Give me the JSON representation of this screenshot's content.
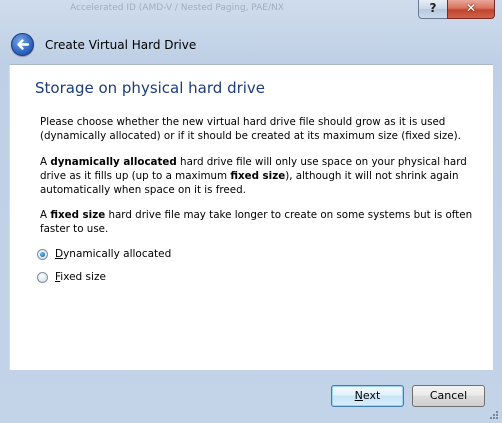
{
  "titlebar": {
    "faded_text": "Accelerated   ID (AMD-V / Nested Paging, PAE/NX",
    "help_glyph": "?",
    "close_glyph": "✕"
  },
  "header": {
    "title": "Create Virtual Hard Drive"
  },
  "page": {
    "title": "Storage on physical hard drive",
    "p1": "Please choose whether the new virtual hard drive file should grow as it is used (dynamically allocated) or if it should be created at its maximum size (fixed size).",
    "p2": {
      "a": "A ",
      "b1": "dynamically allocated",
      "c": " hard drive file will only use space on your physical hard drive as it fills up (up to a maximum ",
      "b2": "fixed size",
      "d": "), although it will not shrink again automatically when space on it is freed."
    },
    "p3": {
      "a": "A ",
      "b1": "fixed size",
      "c": " hard drive file may take longer to create on some systems but is often faster to use."
    }
  },
  "options": {
    "dynamic": {
      "mnemonic": "D",
      "rest": "ynamically allocated",
      "checked": true
    },
    "fixed": {
      "mnemonic": "F",
      "rest": "ixed size",
      "checked": false
    }
  },
  "buttons": {
    "next": {
      "mnemonic": "N",
      "rest": "ext"
    },
    "cancel": "Cancel"
  },
  "colors": {
    "title_blue": "#1c3c7c",
    "frame": "#c3d3e8",
    "close_red": "#c0462c"
  }
}
